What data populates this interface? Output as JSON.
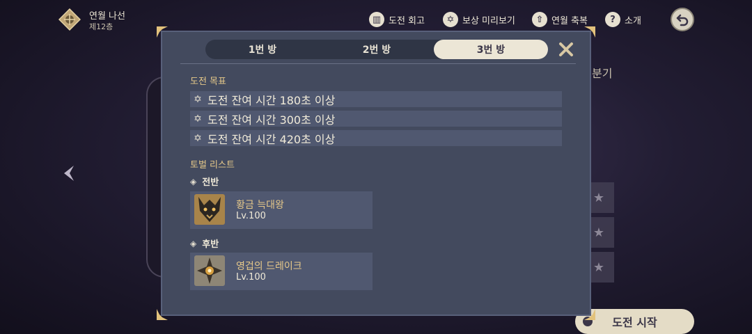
{
  "header": {
    "floor_name": "연월 나선",
    "floor_sub": "제12층",
    "nav": [
      {
        "icon": "book-icon",
        "label": "도전 회고"
      },
      {
        "icon": "star-badge-icon",
        "label": "보상 미리보기"
      },
      {
        "icon": "upload-icon",
        "label": "연월 축복"
      },
      {
        "icon": "question-icon",
        "label": "소개"
      }
    ]
  },
  "background": {
    "side_label": "분기",
    "start_button": "도전 시작"
  },
  "dialog": {
    "tabs": [
      {
        "label": "1번 방",
        "active": false
      },
      {
        "label": "2번 방",
        "active": false
      },
      {
        "label": "3번 방",
        "active": true
      }
    ],
    "goals_title": "도전 목표",
    "goals": [
      "도전 잔여 시간 180초 이상",
      "도전 잔여 시간 300초 이상",
      "도전 잔여 시간 420초 이상"
    ],
    "enemy_list_title": "토벌 리스트",
    "halves": [
      {
        "label": "전반",
        "boss": {
          "name": "황금 늑대왕",
          "level": "Lv.100",
          "icon": "wolf-portrait-icon"
        }
      },
      {
        "label": "후반",
        "boss": {
          "name": "영겁의 드레이크",
          "level": "Lv.100",
          "icon": "drake-portrait-icon"
        }
      }
    ]
  },
  "colors": {
    "panel_bg": "#434a5e",
    "row_bg": "#505870",
    "gold_text": "#e7c98a",
    "active_tab": "#ece6d6"
  }
}
